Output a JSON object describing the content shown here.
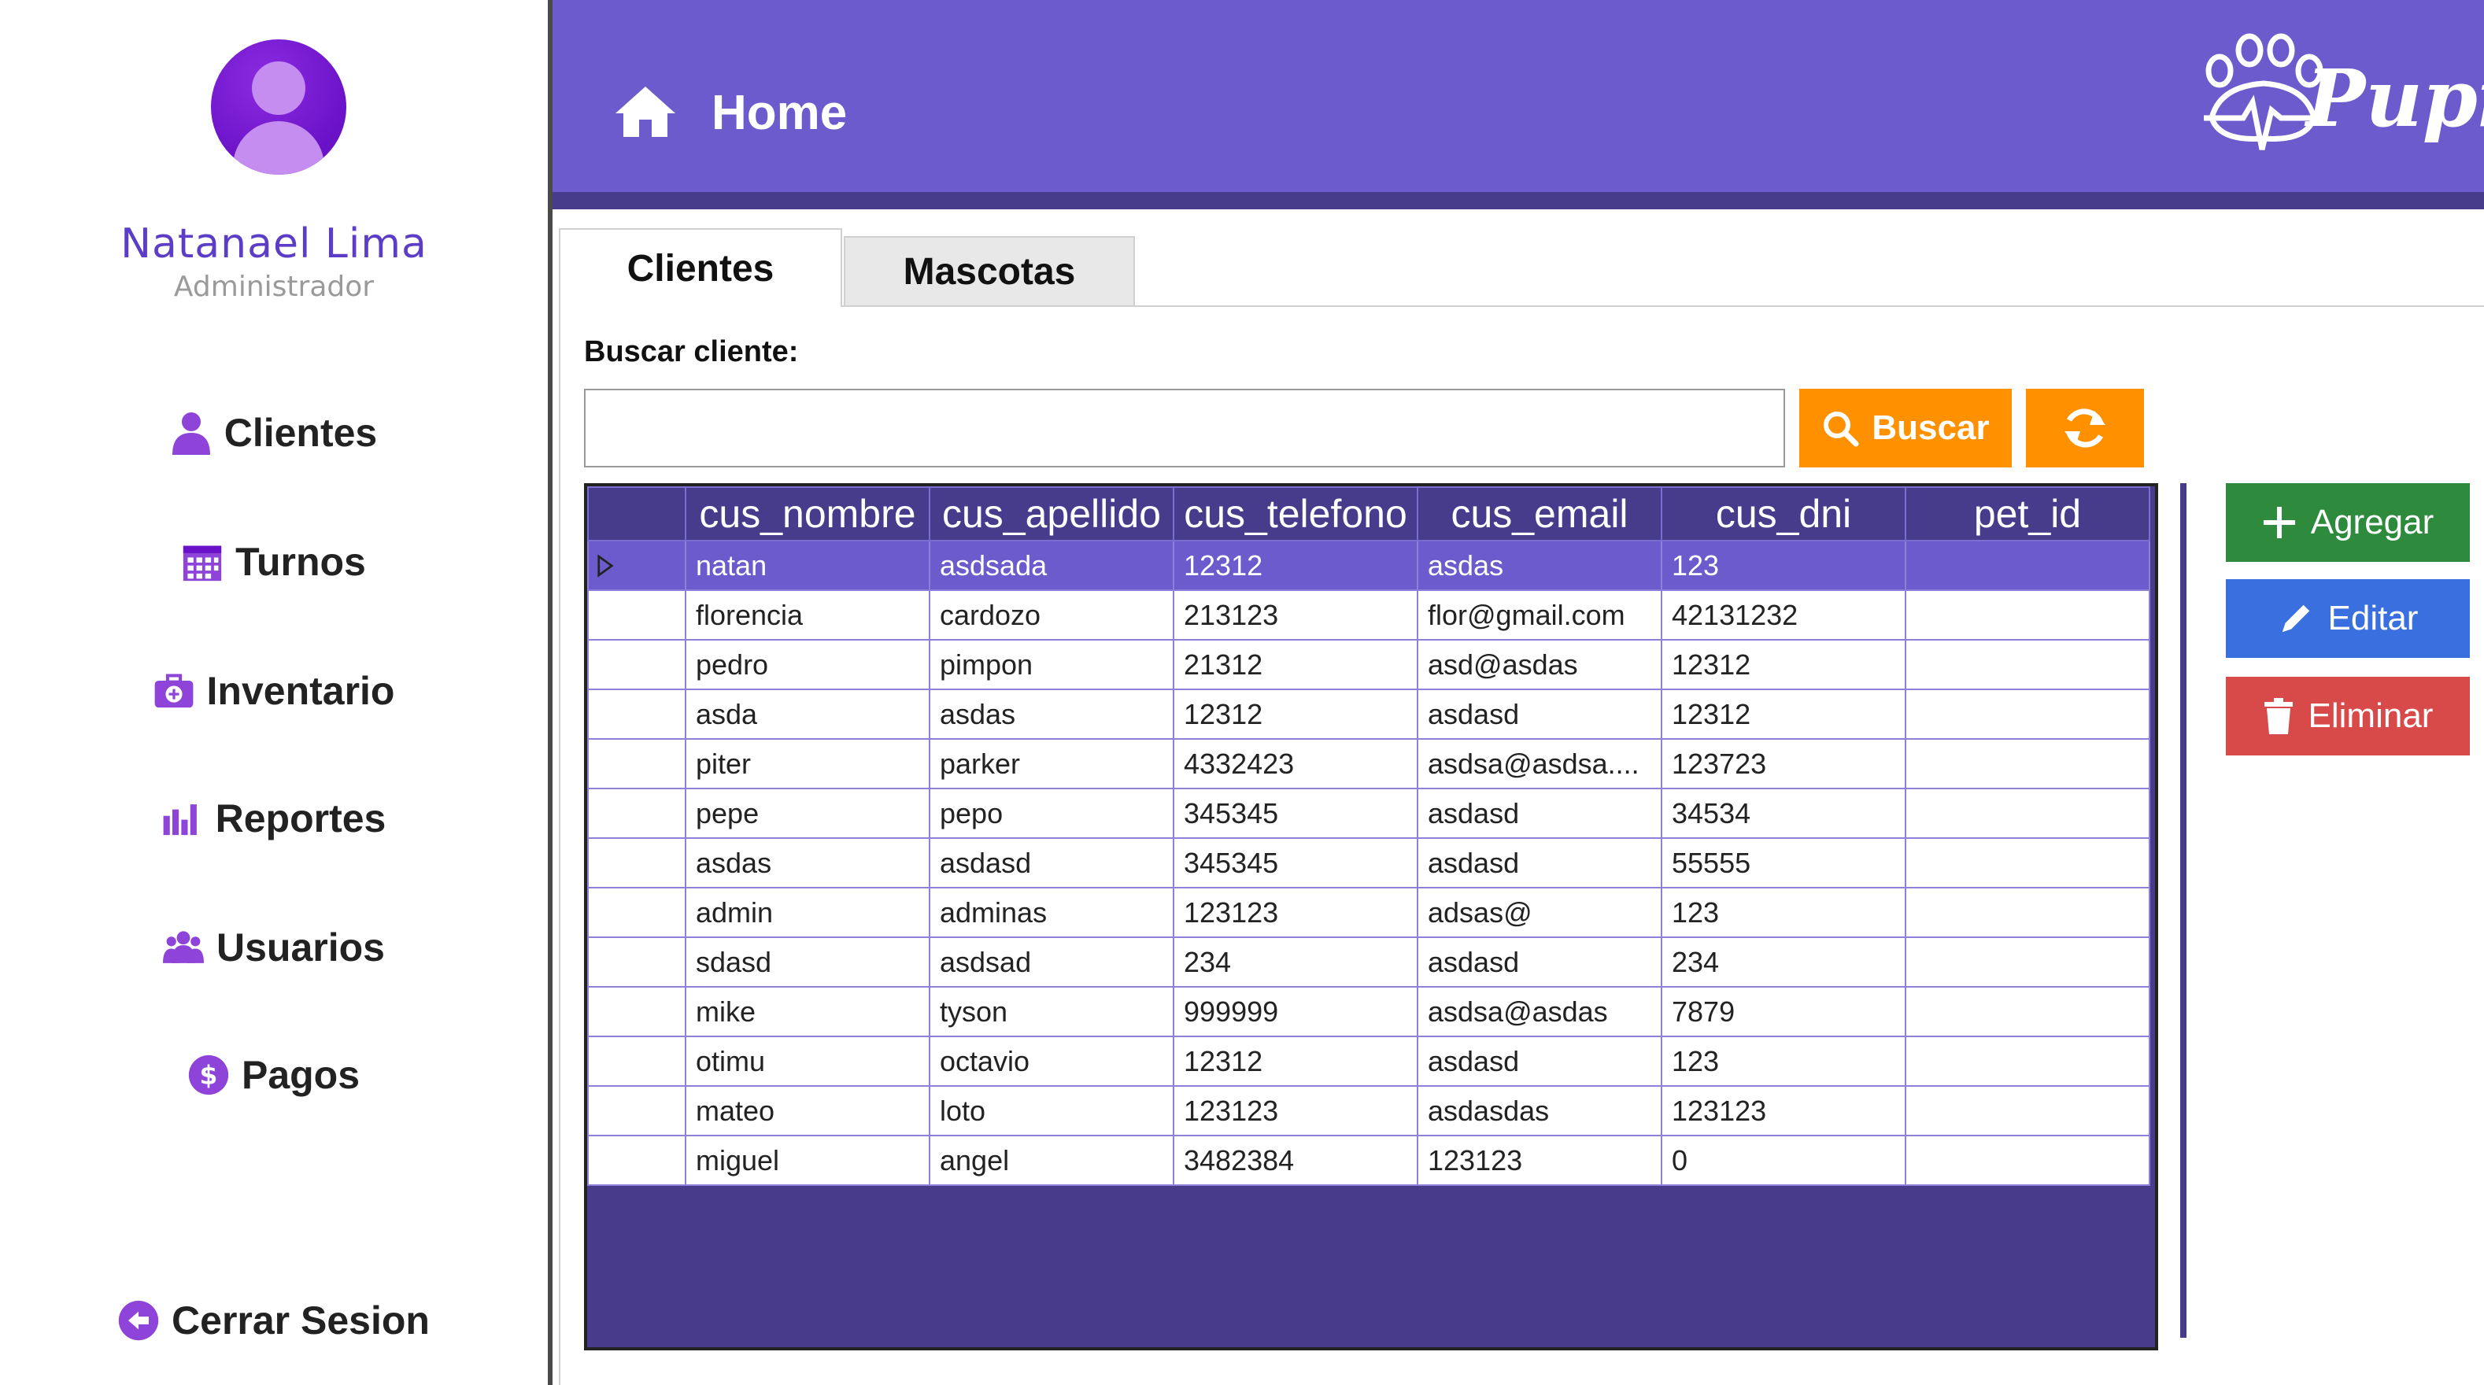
{
  "sidebar": {
    "user_name": "Natanael Lima",
    "user_role": "Administrador",
    "items": [
      {
        "label": "Clientes",
        "icon": "person-icon"
      },
      {
        "label": "Turnos",
        "icon": "calendar-icon"
      },
      {
        "label": "Inventario",
        "icon": "inventory-icon"
      },
      {
        "label": "Reportes",
        "icon": "bar-chart-icon"
      },
      {
        "label": "Usuarios",
        "icon": "users-icon"
      },
      {
        "label": "Pagos",
        "icon": "dollar-icon"
      }
    ],
    "logout_label": "Cerrar Sesion"
  },
  "header": {
    "title": "Home",
    "logo_text": "Pupi"
  },
  "tabs": [
    {
      "label": "Clientes",
      "active": true
    },
    {
      "label": "Mascotas",
      "active": false
    }
  ],
  "search": {
    "label": "Buscar cliente:",
    "value": "",
    "placeholder": "",
    "button_label": "Buscar"
  },
  "actions": {
    "add_label": "Agregar",
    "edit_label": "Editar",
    "delete_label": "Eliminar"
  },
  "table": {
    "columns": [
      "cus_nombre",
      "cus_apellido",
      "cus_telefono",
      "cus_email",
      "cus_dni",
      "pet_id"
    ],
    "selected_row": 0,
    "rows": [
      [
        "natan",
        "asdsada",
        "12312",
        "asdas",
        "123",
        ""
      ],
      [
        "florencia",
        "cardozo",
        "213123",
        "flor@gmail.com",
        "42131232",
        ""
      ],
      [
        "pedro",
        "pimpon",
        "21312",
        "asd@asdas",
        "12312",
        ""
      ],
      [
        "asda",
        "asdas",
        "12312",
        "asdasd",
        "12312",
        ""
      ],
      [
        "piter",
        "parker",
        "4332423",
        "asdsa@asdsa....",
        "123723",
        ""
      ],
      [
        "pepe",
        "pepo",
        "345345",
        "asdasd",
        "34534",
        ""
      ],
      [
        "asdas",
        "asdasd",
        "345345",
        "asdasd",
        "55555",
        ""
      ],
      [
        "admin",
        "adminas",
        "123123",
        "adsas@",
        "123",
        ""
      ],
      [
        "sdasd",
        "asdsad",
        "234",
        "asdasd",
        "234",
        ""
      ],
      [
        "mike",
        "tyson",
        "999999",
        "asdsa@asdas",
        "7879",
        ""
      ],
      [
        "otimu",
        "octavio",
        "12312",
        "asdasd",
        "123",
        ""
      ],
      [
        "mateo",
        "loto",
        "123123",
        "asdasdas",
        "123123",
        ""
      ],
      [
        "miguel",
        "angel",
        "3482384",
        "123123",
        "0",
        ""
      ]
    ]
  },
  "colors": {
    "header": "#6b5bcc",
    "header_strip": "#473c8c",
    "accent_orange": "#ff9000",
    "add_green": "#2e8b3e",
    "edit_blue": "#3a6fe0",
    "delete_red": "#d84a4a",
    "name_purple": "#5b3dc7"
  }
}
